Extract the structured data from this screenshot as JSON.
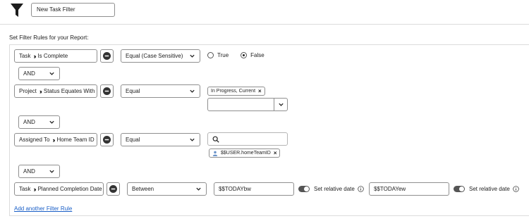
{
  "header": {
    "filter_name": "New Task Filter"
  },
  "section_label": "Set Filter Rules for your Report:",
  "rules": [
    {
      "object": "Task",
      "field": "Is Complete",
      "operator": "Equal (Case Sensitive)",
      "radio_true": "True",
      "radio_false": "False",
      "selected": "False"
    },
    {
      "object": "Project",
      "field": "Status Equates With",
      "operator": "Equal",
      "tag": "In Progress, Current",
      "combo_value": ""
    },
    {
      "object": "Assigned To",
      "field": "Home Team ID",
      "operator": "Equal",
      "search_value": "",
      "tag": "$$USER.homeTeamID"
    },
    {
      "object": "Task",
      "field": "Planned Completion Date",
      "operator": "Between",
      "from_value": "$$TODAYbw",
      "from_toggle_label": "Set relative date",
      "to_value": "$$TODAYew",
      "to_toggle_label": "Set relative date"
    }
  ],
  "connectors": [
    "AND",
    "AND",
    "AND"
  ],
  "add_rule_link": "Add another Filter Rule",
  "icons": {
    "filter": "funnel-icon",
    "remove": "minus-circle-icon",
    "chevron": "chevron-down-icon",
    "search": "search-icon",
    "info": "info-icon",
    "user": "user-icon",
    "close": "close-icon"
  }
}
